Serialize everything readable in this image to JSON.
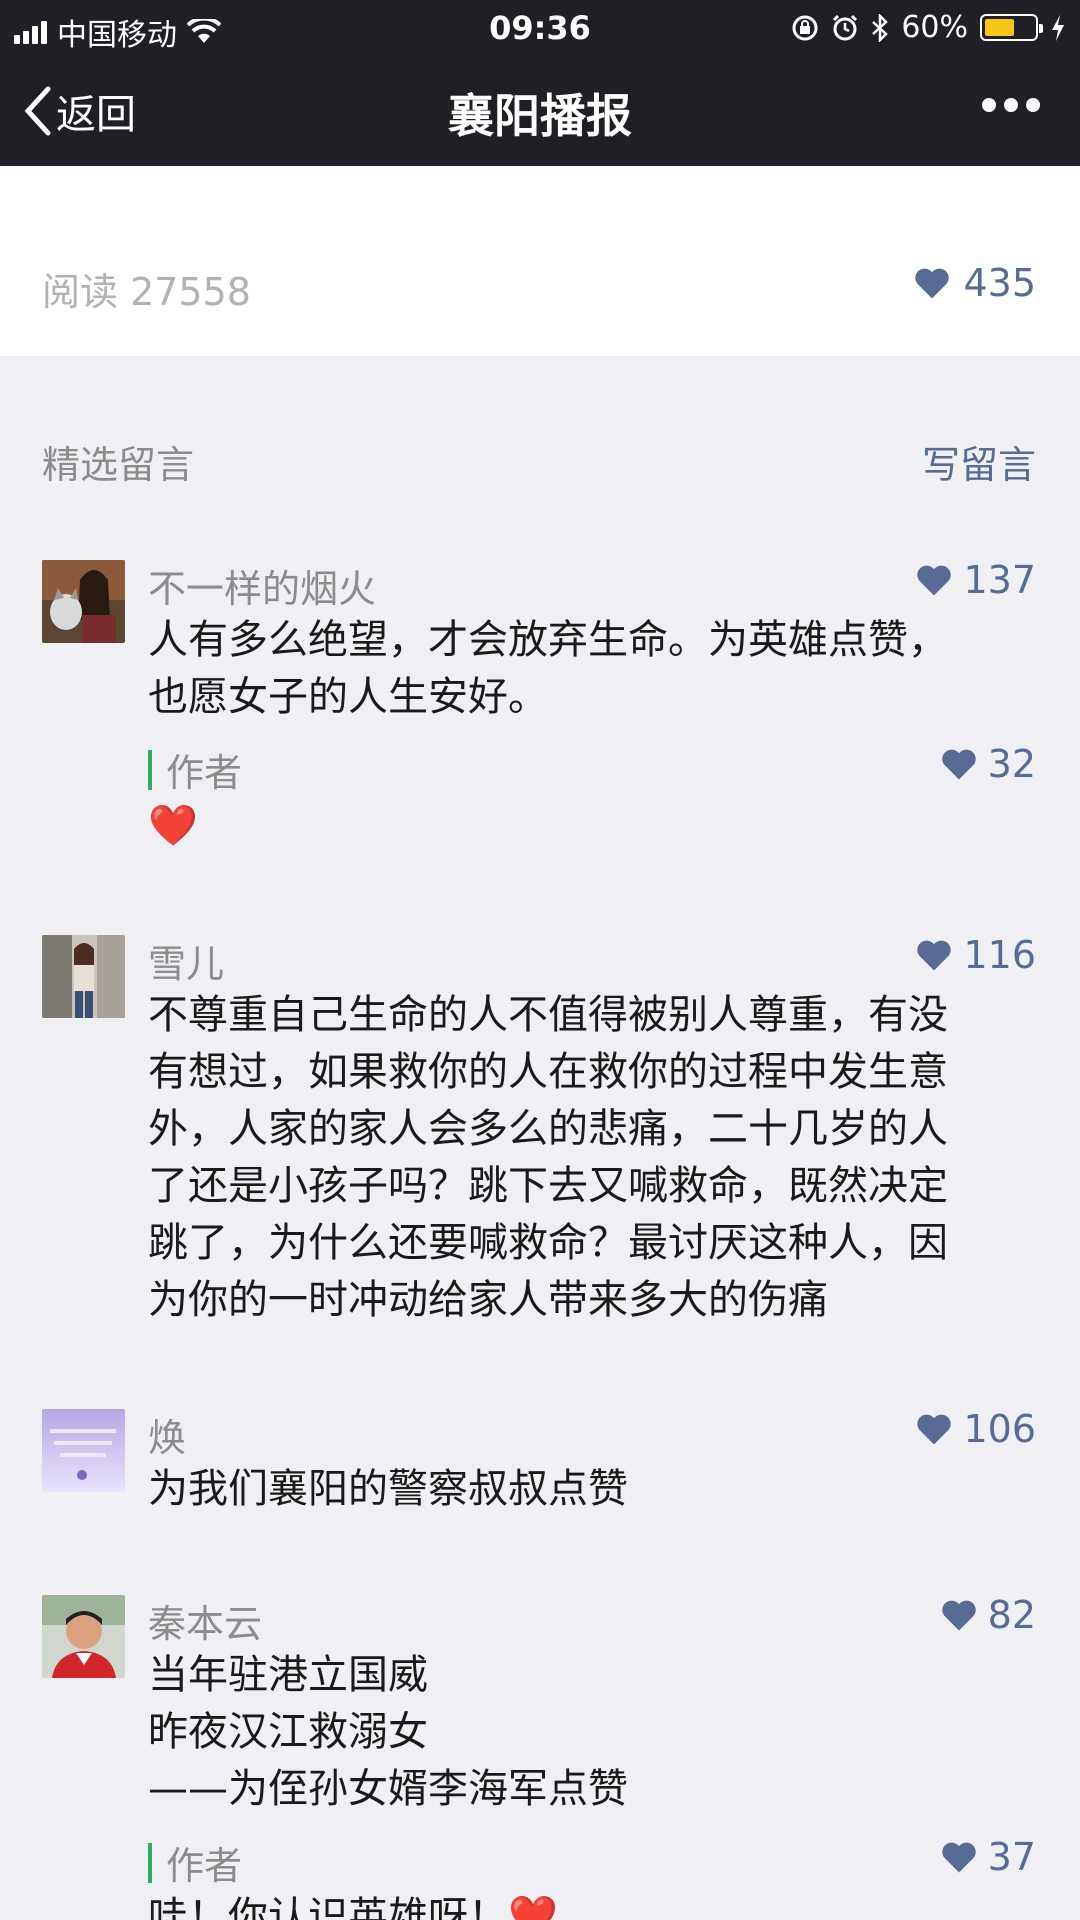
{
  "status_bar": {
    "carrier": "中国移动",
    "time": "09:36",
    "battery_percent": "60%",
    "battery_level": 0.6
  },
  "nav": {
    "back_label": "返回",
    "title": "襄阳播报"
  },
  "stats": {
    "reads": "阅读 27558",
    "likes": "435"
  },
  "comments_section": {
    "title": "精选留言",
    "write_label": "写留言"
  },
  "comments": [
    {
      "name": "不一样的烟火",
      "likes": "137",
      "text": "人有多么绝望，才会放弃生命。为英雄点赞，\n也愿女子的人生安好。",
      "reply": {
        "label": "作者",
        "likes": "32",
        "text": "❤️"
      }
    },
    {
      "name": "雪儿",
      "likes": "116",
      "text": "不尊重自己生命的人不值得被别人尊重，有没\n有想过，如果救你的人在救你的过程中发生意\n外，人家的家人会多么的悲痛，二十几岁的人\n了还是小孩子吗？跳下去又喊救命，既然决定\n跳了，为什么还要喊救命？最讨厌这种人，因\n为你的一时冲动给家人带来多大的伤痛"
    },
    {
      "name": "焕",
      "likes": "106",
      "text": "为我们襄阳的警察叔叔点赞"
    },
    {
      "name": "秦本云",
      "likes": "82",
      "text": "当年驻港立国威\n昨夜汉江救溺女\n——为侄孙女婿李海军点赞",
      "reply": {
        "label": "作者",
        "likes": "37",
        "text": "哇！你认识英雄呀！❤️"
      }
    }
  ],
  "colors": {
    "nav_bg": "#1f1f25",
    "link_blue": "#576b95",
    "author_bar": "#2aae67",
    "battery": "#f5c518"
  },
  "icons": [
    "wifi-icon",
    "lock-rotation-icon",
    "alarm-icon",
    "bluetooth-icon",
    "battery-icon",
    "charging-icon",
    "chevron-left-icon",
    "more-icon",
    "heart-icon"
  ]
}
